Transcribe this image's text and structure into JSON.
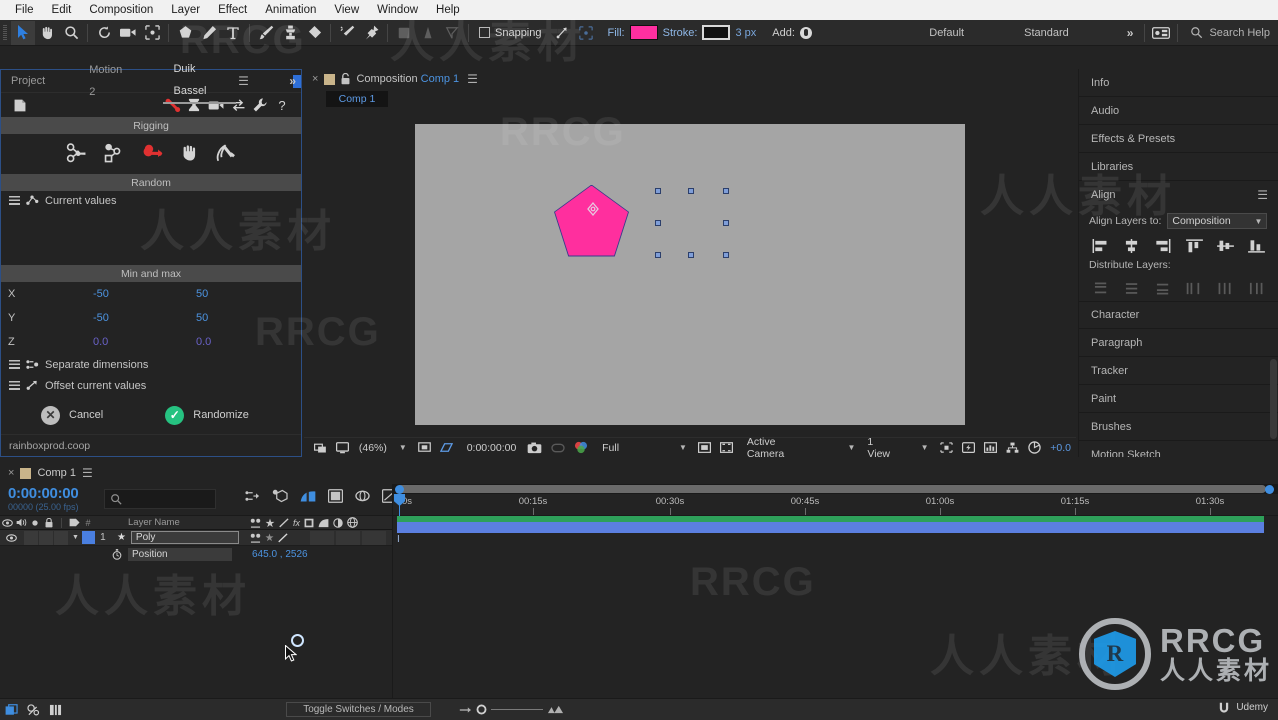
{
  "app": {
    "title": "Adobe After Effects"
  },
  "menubar": {
    "items": [
      "File",
      "Edit",
      "Composition",
      "Layer",
      "Effect",
      "Animation",
      "View",
      "Window",
      "Help"
    ]
  },
  "toolbar": {
    "tools": [
      "selection-tool",
      "hand-tool",
      "zoom-tool",
      "rotation-tool",
      "camera-tool",
      "pan-behind-tool",
      "shape-tool",
      "pen-tool",
      "type-tool",
      "brush-tool",
      "clone-stamp-tool",
      "eraser-tool",
      "roto-brush-tool",
      "puppet-pin-tool"
    ],
    "snapping_label": "Snapping",
    "fill_label": "Fill:",
    "fill_color": "#ff2fa0",
    "stroke_label": "Stroke:",
    "stroke_color": "#101010",
    "stroke_width": "3 px",
    "add_label": "Add:",
    "workspace": "Default",
    "workspace_alt": "Standard",
    "more_chevron": "»",
    "search_placeholder": "Search Help"
  },
  "duik": {
    "tabs": [
      {
        "label": "Project",
        "active": false
      },
      {
        "label": "Motion 2",
        "active": false
      },
      {
        "label": "Duik Bassel",
        "active": true
      }
    ],
    "tab_menu_icon": "panel-menu-icon",
    "overflow_icon": "chevron-double-right-icon",
    "top_icons": [
      "new-doc-icon",
      "duik-bone-icon",
      "hourglass-icon",
      "camera-icon",
      "swap-icon",
      "wrench-icon",
      "help-icon"
    ],
    "sections": [
      {
        "label": "Rigging",
        "icons": [
          "auto-rig-icon",
          "structure-icon",
          "duik-link-icon",
          "hand-icon",
          "sickle-hammer-icon"
        ]
      },
      {
        "label": "Random"
      }
    ],
    "current_values_label": "Current values",
    "minmax_label": "Min and max",
    "axes": [
      {
        "axis": "X",
        "min": "-50",
        "max": "50",
        "color": "#4c93e0"
      },
      {
        "axis": "Y",
        "min": "-50",
        "max": "50",
        "color": "#4c93e0"
      },
      {
        "axis": "Z",
        "min": "0.0",
        "max": "0.0",
        "color": "#6a62c8"
      }
    ],
    "options": [
      {
        "label": "Separate dimensions",
        "icon": "separate-dimensions-icon"
      },
      {
        "label": "Offset current values",
        "icon": "offset-values-icon"
      }
    ],
    "cancel_label": "Cancel",
    "randomize_label": "Randomize",
    "footer": "rainboxprod.coop"
  },
  "composition": {
    "close_icon": "close-icon",
    "lock_icon": "lock-icon",
    "title_prefix": "Composition",
    "title_name": "Comp 1",
    "panel_menu_icon": "panel-menu-icon",
    "tab_label": "Comp 1",
    "shape_color": "#ff2f9e",
    "shape_name": "pentagon-shape",
    "bottombar": {
      "zoom": "(46%)",
      "time": "0:00:00:00",
      "resolution": "Full",
      "view_camera": "Active Camera",
      "view_count": "1 View",
      "exposure": "+0.0"
    }
  },
  "right_panel": {
    "rows": [
      "Info",
      "Audio",
      "Effects & Presets",
      "Libraries"
    ],
    "align": {
      "title": "Align",
      "menu_icon": "panel-menu-icon",
      "align_to_label": "Align Layers to:",
      "align_to_value": "Composition",
      "align_icons": [
        "align-left-icon",
        "align-horizontal-center-icon",
        "align-right-icon",
        "align-top-icon",
        "align-vertical-center-icon",
        "align-bottom-icon"
      ],
      "distribute_label": "Distribute Layers:",
      "distribute_icons": [
        "distribute-top-icon",
        "distribute-vertical-center-icon",
        "distribute-bottom-icon",
        "distribute-left-icon",
        "distribute-horizontal-center-icon",
        "distribute-right-icon"
      ]
    },
    "rows2": [
      "Character",
      "Paragraph",
      "Tracker",
      "Paint",
      "Brushes",
      "Motion Sketch"
    ]
  },
  "timeline": {
    "close_icon": "close-icon",
    "comp_name": "Comp 1",
    "panel_menu_icon": "panel-menu-icon",
    "current_time": "0:00:00:00",
    "current_time_sub": "00000 (25.00 fps)",
    "search_placeholder": "",
    "tools": [
      "live-update-icon",
      "draft-3d-icon",
      "motion-blur-icon",
      "graph-editor-icon",
      "brainstorm-icon",
      "auto-keyframe-icon"
    ],
    "columns": {
      "layer_name": "Layer Name"
    },
    "switch_icons": [
      "shy-icon",
      "collapse-transform-icon",
      "quality-icon",
      "effects-icon",
      "frame-blend-icon",
      "motion-blur-icon",
      "adjustment-icon",
      "3d-layer-icon"
    ],
    "layers": [
      {
        "index": "1",
        "name": "Poly",
        "color": "#4a7fe0",
        "star": "★",
        "properties": [
          {
            "name": "Position",
            "value": "645.0 , 2526",
            "stopwatch": "stopwatch-icon"
          }
        ]
      }
    ],
    "ruler_labels": [
      "0s",
      "00:15s",
      "00:30s",
      "00:45s",
      "01:00s",
      "01:15s",
      "01:30s"
    ],
    "footer": {
      "toggle_label": "Toggle Switches / Modes",
      "icons": [
        "comp-flowchart-icon",
        "hide-shy-icon",
        "frame-blend-icon"
      ]
    }
  },
  "watermarks": {
    "chinese": "人人素材",
    "english": "RRCG",
    "logo_en": "RRCG",
    "logo_cn": "人人素材",
    "udemy": "Udemy"
  }
}
